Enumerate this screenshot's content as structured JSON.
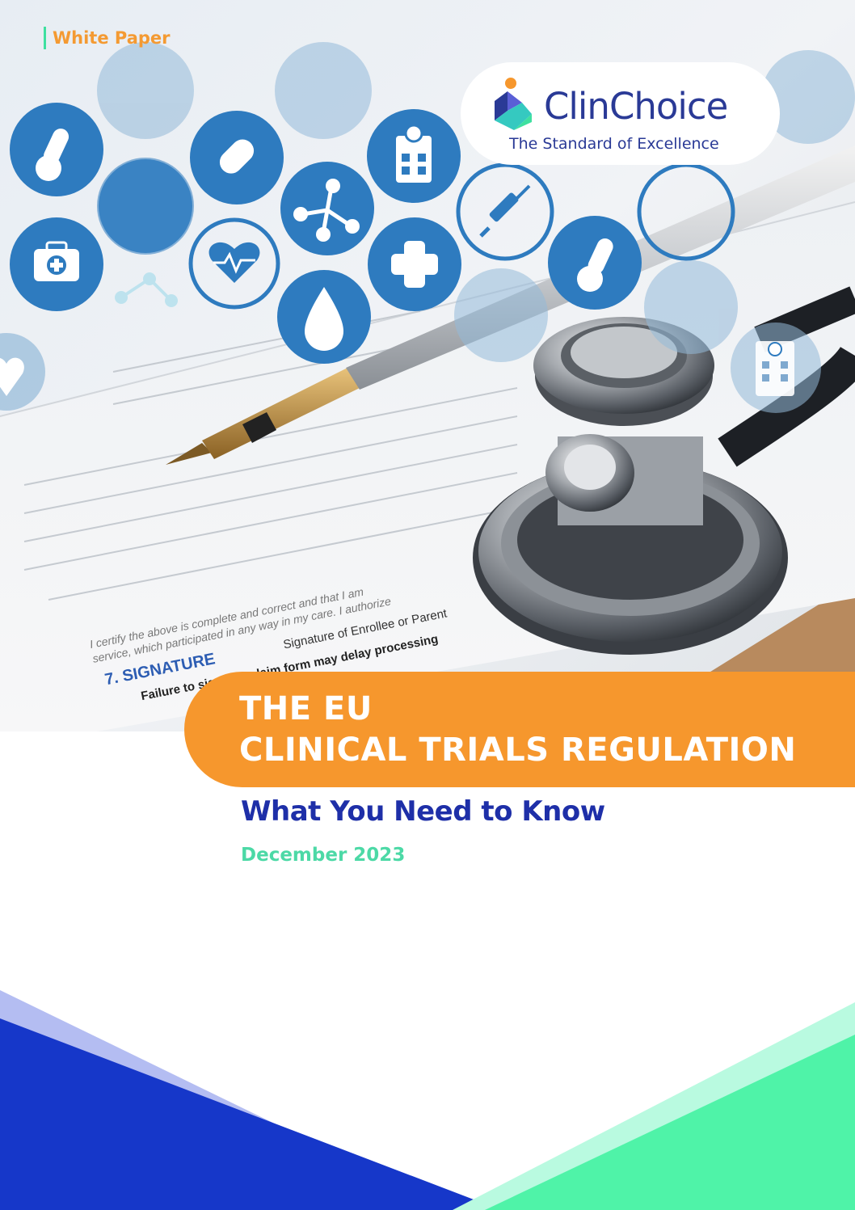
{
  "document": {
    "label": "White Paper",
    "title_line_1": "THE EU",
    "title_line_2": "CLINICAL TRIALS REGULATION",
    "subtitle": "What You Need to Know",
    "date": "December 2023"
  },
  "brand": {
    "name": "ClinChoice",
    "tagline": "The Standard of Excellence"
  },
  "photo_text": {
    "signature_heading": "7. SIGNATURE",
    "signature_field": "Signature of Enrollee or Parent",
    "warning": "Failure to sign this claim form may delay processing",
    "certify_1": "I certify the above is complete and correct and that I am",
    "certify_2": "service, which participated in any way in my care. I authorize"
  },
  "colors": {
    "orange": "#f6972d",
    "navy": "#1e2fa8",
    "brand_blue": "#2a3a96",
    "mint": "#4cd9a6",
    "icon_blue": "#2e7bbf",
    "footer_blue": "#1637c9",
    "footer_green": "#4ff3a8"
  },
  "icons": [
    "thermometer-icon",
    "pill-icon",
    "clinic-icon",
    "syringe-icon",
    "first-aid-kit-icon",
    "heartbeat-icon",
    "molecule-icon",
    "medical-cross-icon",
    "droplet-icon",
    "heart-icon",
    "hospital-building-icon"
  ]
}
